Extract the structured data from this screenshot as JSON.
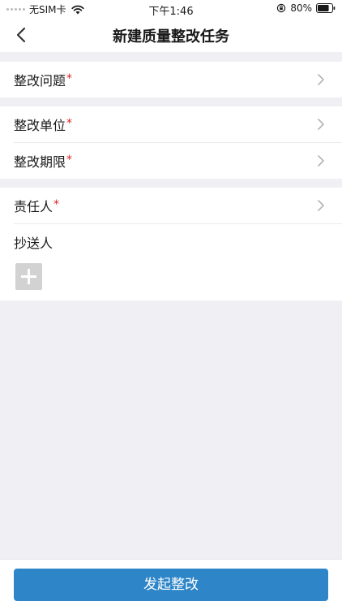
{
  "status_bar": {
    "carrier": "无SIM卡",
    "time": "下午1:46",
    "battery": "80%"
  },
  "nav": {
    "title": "新建质量整改任务"
  },
  "form": {
    "section1": {
      "rows": [
        {
          "label": "整改问题",
          "required": "*"
        }
      ]
    },
    "section2": {
      "rows": [
        {
          "label": "整改单位",
          "required": "*"
        },
        {
          "label": "整改期限",
          "required": "*"
        }
      ]
    },
    "section3": {
      "rows": [
        {
          "label": "责任人",
          "required": "*"
        }
      ],
      "cc_label": "抄送人"
    }
  },
  "footer": {
    "submit_label": "发起整改"
  },
  "colors": {
    "accent": "#2e86c8",
    "required": "#e02020",
    "background": "#f0f0f4"
  },
  "icons": {
    "back": "back-chevron-icon",
    "row_arrow": "chevron-right-icon",
    "add": "plus-icon"
  }
}
